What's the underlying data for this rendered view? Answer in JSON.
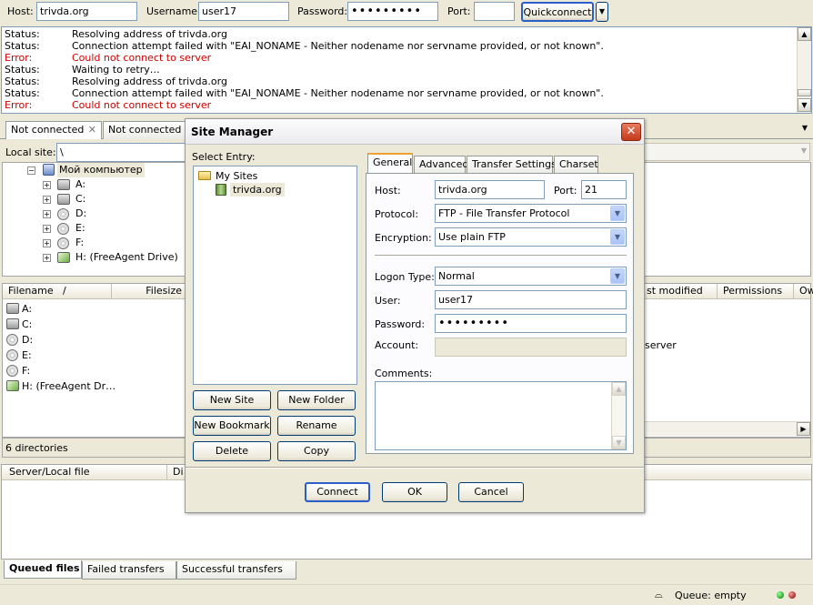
{
  "quickbar": {
    "host_label": "Host:",
    "host_value": "trivda.org",
    "user_label": "Username:",
    "user_value": "user17",
    "pass_label": "Password:",
    "pass_value": "•••••••••",
    "port_label": "Port:",
    "port_value": "",
    "quickconnect": "Quickconnect",
    "dropdown_icon": "chevron-down-icon"
  },
  "log": [
    {
      "type": "Status:",
      "msg": "Resolving address of trivda.org"
    },
    {
      "type": "Status:",
      "msg": "Connection attempt failed with \"EAI_NONAME - Neither nodename nor servname provided, or not known\"."
    },
    {
      "type": "Error:",
      "msg": "Could not connect to server"
    },
    {
      "type": "Status:",
      "msg": "Waiting to retry…"
    },
    {
      "type": "Status:",
      "msg": "Resolving address of trivda.org"
    },
    {
      "type": "Status:",
      "msg": "Connection attempt failed with \"EAI_NONAME - Neither nodename nor servname provided, or not known\"."
    },
    {
      "type": "Error:",
      "msg": "Could not connect to server"
    }
  ],
  "conn_tabs": [
    "Not connected",
    "Not connected"
  ],
  "local": {
    "site_label": "Local site:",
    "site_value": "\\",
    "tree_root": "Мой компьютер",
    "drives": [
      "A:",
      "C:",
      "D:",
      "E:",
      "F:",
      "H: (FreeAgent Drive)"
    ]
  },
  "filelist": {
    "columns": [
      "Filename",
      "/",
      "Filesize"
    ],
    "items": [
      "A:",
      "C:",
      "D:",
      "E:",
      "F:",
      "H: (FreeAgent Dr…"
    ],
    "status": "6 directories"
  },
  "remote": {
    "columns": [
      "st modified",
      "Permissions",
      "Ow"
    ],
    "server_text": "server"
  },
  "queue": {
    "columns": [
      "Server/Local file",
      "Di"
    ],
    "tabs": [
      "Queued files",
      "Failed transfers",
      "Successful transfers"
    ],
    "status": "Queue: empty"
  },
  "dialog": {
    "title": "Site Manager",
    "select_entry": "Select Entry:",
    "tree_folder": "My Sites",
    "tree_site": "trivda.org",
    "buttons": [
      "New Site",
      "New Folder",
      "New Bookmark",
      "Rename",
      "Delete",
      "Copy"
    ],
    "tabs": [
      "General",
      "Advanced",
      "Transfer Settings",
      "Charset"
    ],
    "host_label": "Host:",
    "host_value": "trivda.org",
    "port_label": "Port:",
    "port_value": "21",
    "protocol_label": "Protocol:",
    "protocol_value": "FTP - File Transfer Protocol",
    "encryption_label": "Encryption:",
    "encryption_value": "Use plain FTP",
    "logon_label": "Logon Type:",
    "logon_value": "Normal",
    "user_label": "User:",
    "user_value": "user17",
    "password_label": "Password:",
    "password_value": "•••••••••",
    "account_label": "Account:",
    "account_value": "",
    "comments_label": "Comments:",
    "footer": [
      "Connect",
      "OK",
      "Cancel"
    ]
  }
}
